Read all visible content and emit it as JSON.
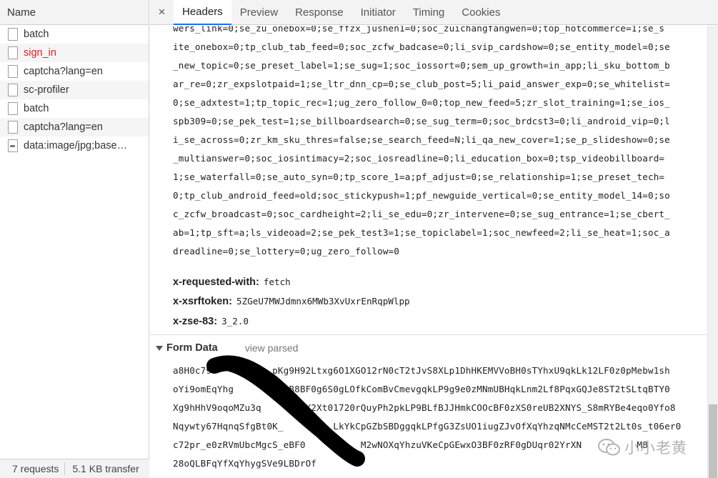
{
  "left_panel": {
    "header": "Name",
    "requests": [
      {
        "name": "batch",
        "icon": "file-icon",
        "error": false
      },
      {
        "name": "sign_in",
        "icon": "file-icon",
        "error": true
      },
      {
        "name": "captcha?lang=en",
        "icon": "file-icon",
        "error": false
      },
      {
        "name": "sc-profiler",
        "icon": "file-icon",
        "error": false
      },
      {
        "name": "batch",
        "icon": "file-icon",
        "error": false
      },
      {
        "name": "captcha?lang=en",
        "icon": "file-icon",
        "error": false
      },
      {
        "name": "data:image/jpg;base…",
        "icon": "image-file-icon",
        "error": false
      }
    ],
    "status": {
      "requests": "7 requests",
      "transfer": "5.1 KB transfer"
    }
  },
  "tabs": {
    "close": "×",
    "items": [
      "Headers",
      "Preview",
      "Response",
      "Initiator",
      "Timing",
      "Cookies"
    ],
    "active": "Headers"
  },
  "cookie_lines": [
    "wers_link=0;se_zu_onebox=0;se_ffzx_jushen1=0;soc_zuichangfangwen=0;top_hotcommerce=1;se_s",
    "ite_onebox=0;tp_club_tab_feed=0;soc_zcfw_badcase=0;li_svip_cardshow=0;se_entity_model=0;se",
    "_new_topic=0;se_preset_label=1;se_sug=1;soc_iossort=0;sem_up_growth=in_app;li_sku_bottom_b",
    "ar_re=0;zr_expslotpaid=1;se_ltr_dnn_cp=0;se_club_post=5;li_paid_answer_exp=0;se_whitelist=",
    "0;se_adxtest=1;tp_topic_rec=1;ug_zero_follow_0=0;top_new_feed=5;zr_slot_training=1;se_ios_",
    "spb309=0;se_pek_test=1;se_billboardsearch=0;se_sug_term=0;soc_brdcst3=0;li_android_vip=0;l",
    "i_se_across=0;zr_km_sku_thres=false;se_search_feed=N;li_qa_new_cover=1;se_p_slideshow=0;se",
    "_multianswer=0;soc_iosintimacy=2;soc_iosreadline=0;li_education_box=0;tsp_videobillboard=",
    "1;se_waterfall=0;se_auto_syn=0;tp_score_1=a;pf_adjust=0;se_relationship=1;se_preset_tech=",
    "0;tp_club_android_feed=old;soc_stickypush=1;pf_newguide_vertical=0;se_entity_model_14=0;so",
    "c_zcfw_broadcast=0;soc_cardheight=2;li_se_edu=0;zr_intervene=0;se_sug_entrance=1;se_cbert_",
    "ab=1;tp_sft=a;ls_videoad=2;se_pek_test3=1;se_topiclabel=1;soc_newfeed=2;li_se_heat=1;soc_a",
    "dreadline=0;se_lottery=0;ug_zero_follow=0"
  ],
  "headers": [
    {
      "key": "x-requested-with:",
      "value": "fetch"
    },
    {
      "key": "x-xsrftoken:",
      "value": "5ZGeU7MWJdmnx6MWb3XvUxrEnRqpWlpp"
    },
    {
      "key": "x-zse-83:",
      "value": "3_2.0"
    }
  ],
  "form_data": {
    "title": "Form Data",
    "view_link": "view parsed",
    "lines": [
      "a8H0c79      LF0z_pKg9H92Ltxg6O1XGO12rN0cT2tJvS8XLp1DhHKEMVVoBH0sTYhxU9qkLk12LF0z0pMebw1sh",
      "oYi9omEqYhg        BOB8BF0g6S0gLOfkComBvCmevgqkLP9g9e0zMNmUBHqkLnm2Lf8PqxGQJe8ST2tSLtqBTY0",
      "Xg9hHhV9oqoMZu3q       FX2Xt01720rQuyPh2pkLP9BLfBJJHmkCOOcBF0zXS0reUB2XNYS_S8mRYBe4eqo0Yfo8",
      "Nqywty67HqnqSfgBt0K_         LkYkCpGZbSBDggqkLPfgG3ZsUO1iugZJvOfXqYhzqNMcCeMST2t2Lt0s_t06er0",
      "c72pr_e0zRVmUbcMgcS_eBF0          M2wNOXqYhzuVKeCpGEwxO3BF0zRF0gDUqr02YrXN          M8",
      "28oQLBFqYfXqYhygSVe9LBDrOf"
    ]
  },
  "watermark": "小小老黄"
}
